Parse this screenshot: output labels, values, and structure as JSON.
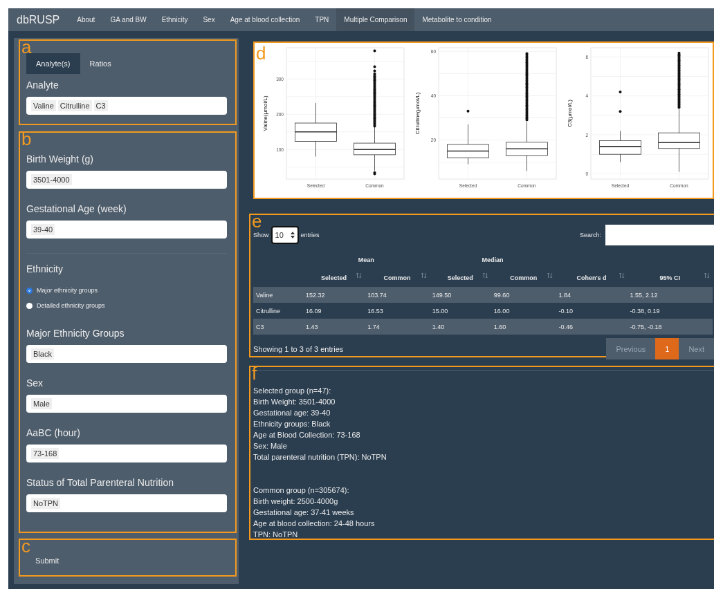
{
  "navbar": {
    "brand": "dbRUSP",
    "items": [
      {
        "label": "About",
        "selected": false
      },
      {
        "label": "GA and BW",
        "selected": false
      },
      {
        "label": "Ethnicity",
        "selected": false
      },
      {
        "label": "Sex",
        "selected": false
      },
      {
        "label": "Age at blood collection",
        "selected": false
      },
      {
        "label": "TPN",
        "selected": false
      },
      {
        "label": "Multiple Comparison",
        "selected": true
      },
      {
        "label": "Metabolite to condition",
        "selected": false
      }
    ]
  },
  "analytes": {
    "annotation": "a",
    "tabs": [
      {
        "label": "Analyte(s)",
        "selected": true
      },
      {
        "label": "Ratios",
        "selected": false
      }
    ],
    "label": "Analyte",
    "values": [
      "Valine",
      "Citrulline",
      "C3"
    ]
  },
  "filters": {
    "annotation": "b",
    "fields": [
      {
        "kind": "select",
        "label": "Birth Weight (g)",
        "values": [
          "3501-4000"
        ]
      },
      {
        "kind": "select",
        "label": "Gestational Age (week)",
        "values": [
          "39-40"
        ]
      },
      {
        "kind": "divider"
      },
      {
        "kind": "radio",
        "label": "Ethnicity",
        "options": [
          {
            "label": "Major ethnicity groups",
            "selected": true
          },
          {
            "label": "Detailed ethnicity groups",
            "selected": false
          }
        ]
      },
      {
        "kind": "select",
        "label": "Major Ethnicity Groups",
        "values": [
          "Black"
        ]
      },
      {
        "kind": "select",
        "label": "Sex",
        "values": [
          "Male"
        ]
      },
      {
        "kind": "select",
        "label": "AaBC (hour)",
        "values": [
          "73-168"
        ]
      },
      {
        "kind": "select",
        "label": "Status of Total Parenteral Nutrition",
        "values": [
          "NoTPN"
        ]
      }
    ]
  },
  "submit": {
    "annotation": "c",
    "label": "Submit"
  },
  "plots": {
    "annotation": "d",
    "panels": [
      {
        "ylabel": "Valine(μmol/L)",
        "yticks": [
          "300",
          "200",
          "100"
        ],
        "categories": [
          "Selected",
          "Common"
        ]
      },
      {
        "ylabel": "Citrulline(μmol/L)",
        "yticks": [
          "60",
          "40",
          "20"
        ],
        "categories": [
          "Selected",
          "Common"
        ]
      },
      {
        "ylabel": "C3(μmol/L)",
        "yticks": [
          "6",
          "4",
          "2",
          "0"
        ],
        "categories": [
          "Selected",
          "Common"
        ]
      }
    ]
  },
  "table": {
    "annotation": "e",
    "show_label": "Show",
    "length": "10",
    "entries_label": "entries",
    "search_label": "Search:",
    "groups": [
      {
        "label": "Mean",
        "columns": [
          "Selected",
          "Common"
        ]
      },
      {
        "label": "Median",
        "columns": [
          "Selected",
          "Common"
        ]
      }
    ],
    "extra_columns": [
      "Cohen's d",
      "95% CI"
    ],
    "rows": [
      {
        "cells": [
          "Valine",
          "152.32",
          "103.74",
          "149.50",
          "99.60",
          "1.84",
          "1.55, 2.12"
        ]
      },
      {
        "cells": [
          "Citrulline",
          "16.09",
          "16.53",
          "15.00",
          "16.00",
          "-0.10",
          "-0.38, 0.19"
        ]
      },
      {
        "cells": [
          "C3",
          "1.43",
          "1.74",
          "1.40",
          "1.60",
          "-0.46",
          "-0.75, -0.18"
        ]
      }
    ],
    "info": "Showing 1 to 3 of 3 entries",
    "pages": [
      {
        "label": "Previous",
        "selected": false,
        "disabled": true
      },
      {
        "label": "1",
        "selected": true,
        "disabled": false
      },
      {
        "label": "Next",
        "selected": false,
        "disabled": true
      }
    ]
  },
  "summary": {
    "annotation": "f",
    "groups": [
      {
        "lines": [
          "Selected group (n=47):",
          "Birth Weight: 3501-4000",
          "Gestational age: 39-40",
          "Ethnicity groups: Black",
          "Age at Blood Collection: 73-168",
          "Sex: Male",
          "Total parenteral nutrition (TPN): NoTPN"
        ]
      },
      {
        "lines": [
          "Common group (n=305674):",
          "Birth weight: 2500-4000g",
          "Gestational age: 37-41 weeks",
          "Age at blood collection: 24-48 hours",
          "TPN: NoTPN"
        ]
      }
    ]
  }
}
